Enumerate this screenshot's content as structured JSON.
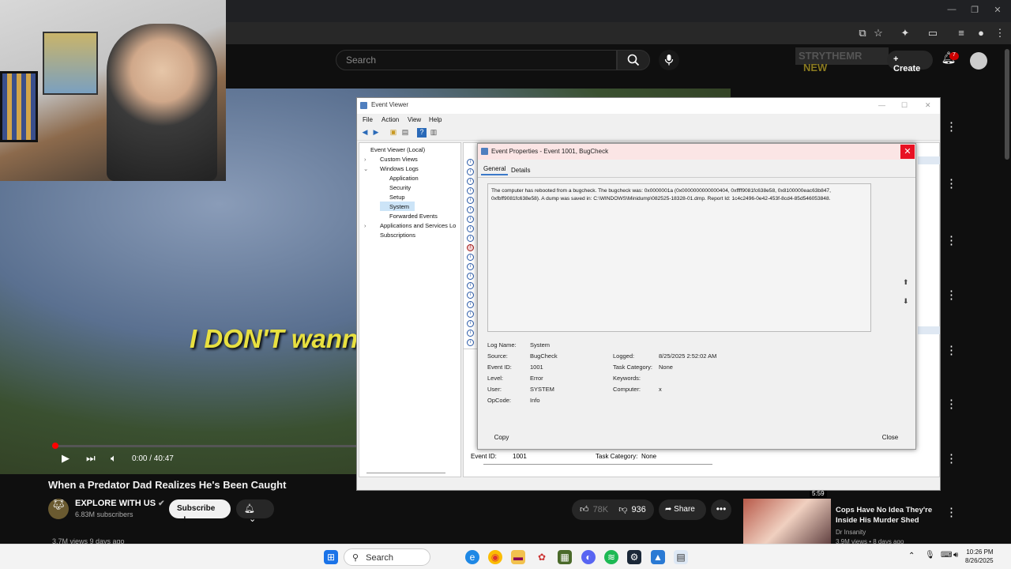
{
  "browser": {
    "window_minimize": "—",
    "window_restore": "❐",
    "window_close": "✕"
  },
  "youtube": {
    "search_placeholder": "Search",
    "watermark": "STRYTHEMR",
    "watermark_new": "NEW",
    "create_label": "Create",
    "notification_count": "7",
    "video": {
      "subtitle": "I DON'T wann",
      "time": "0:00 / 40:47",
      "title": "When a Predator Dad Realizes He's Been Caught",
      "channel": "EXPLORE WITH US",
      "subscribers": "6.83M subscribers",
      "subscribe_label": "Subscribe",
      "views": "3.7M views  9 days ago",
      "likes": "78K",
      "dislikes": "936",
      "share_label": "Share"
    },
    "recommendation": {
      "duration": "5:59",
      "title": "Cops Have No Idea They're Inside His Murder Shed",
      "channel": "Dr Insanity",
      "meta": "3.9M views • 8 days ago"
    }
  },
  "event_viewer": {
    "title": "Event Viewer",
    "menu": [
      "File",
      "Action",
      "View",
      "Help"
    ],
    "tree": {
      "root": "Event Viewer (Local)",
      "custom_views": "Custom Views",
      "windows_logs": "Windows Logs",
      "application": "Application",
      "security": "Security",
      "setup": "Setup",
      "system": "System",
      "forwarded": "Forwarded Events",
      "apps_services": "Applications and Services Lo",
      "subscriptions": "Subscriptions"
    },
    "lower_event_id_label": "Event ID:",
    "lower_event_id": "1001",
    "lower_task_label": "Task Category:",
    "lower_task": "None"
  },
  "dialog": {
    "title": "Event Properties - Event 1001, BugCheck",
    "tabs": {
      "general": "General",
      "details": "Details"
    },
    "description": "The computer has rebooted from a bugcheck.  The bugcheck was: 0x0000001a (0x0000000000000404, 0xffff9081fc638e58, 0x8100000eac63b847, 0xfbff9081fc638e58). A dump was saved in: C:\\WINDOWS\\Minidump\\082525-18328-01.dmp. Report Id: 1c4c2496-0e42-453f-8cd4-85d546053848.",
    "fields": {
      "log_name_label": "Log Name:",
      "log_name": "System",
      "source_label": "Source:",
      "source": "BugCheck",
      "event_id_label": "Event ID:",
      "event_id": "1001",
      "level_label": "Level:",
      "level": "Error",
      "user_label": "User:",
      "user": "SYSTEM",
      "opcode_label": "OpCode:",
      "opcode": "Info",
      "logged_label": "Logged:",
      "logged": "8/25/2025 2:52:02 AM",
      "task_category_label": "Task Category:",
      "task_category": "None",
      "keywords_label": "Keywords:",
      "keywords": "",
      "computer_label": "Computer:",
      "computer": "x"
    },
    "copy_label": "Copy",
    "close_label": "Close"
  },
  "taskbar": {
    "search_label": "Search",
    "time": "10:26 PM",
    "date": "8/26/2025"
  },
  "colors": {
    "youtube_red": "#ff0000",
    "close_red": "#e81123",
    "subtitle_yellow": "#e8e040"
  }
}
